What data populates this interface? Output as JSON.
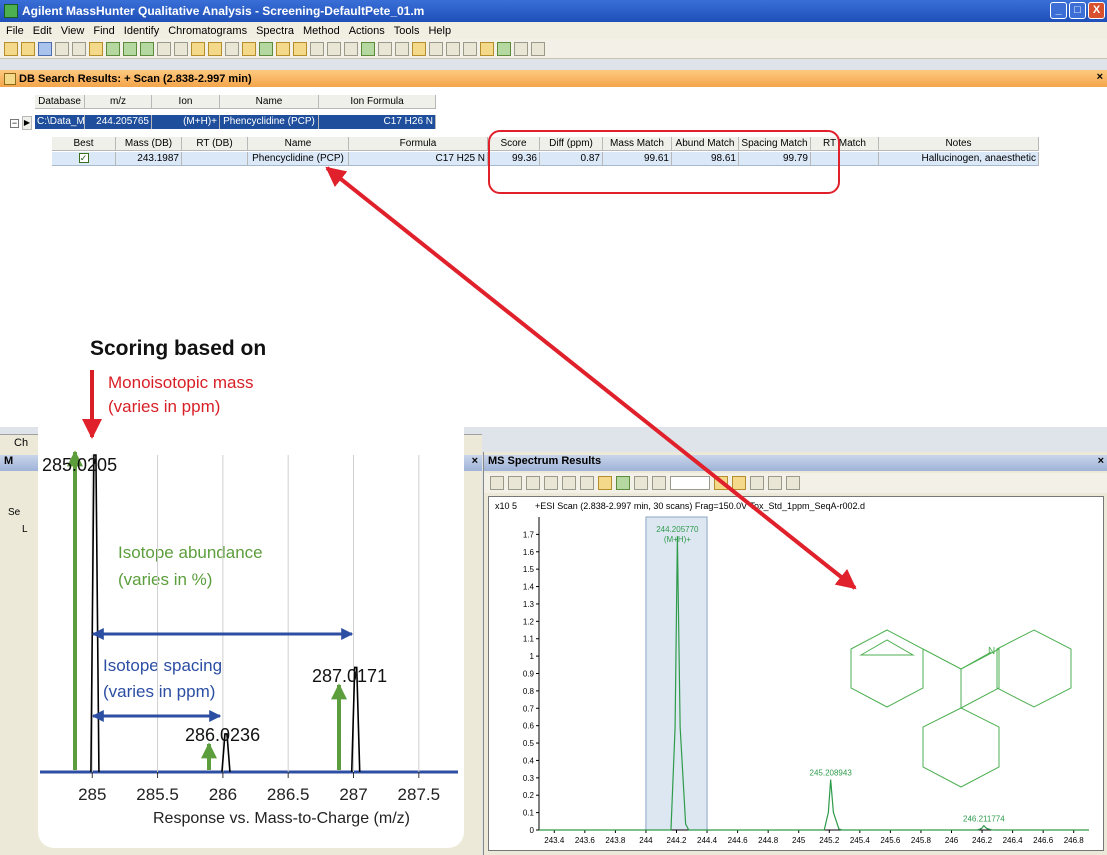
{
  "window": {
    "title": "Agilent MassHunter Qualitative Analysis - Screening-DefaultPete_01.m",
    "min_label": "_",
    "max_label": "□",
    "close_label": "X"
  },
  "menu": [
    "File",
    "Edit",
    "View",
    "Find",
    "Identify",
    "Chromatograms",
    "Spectra",
    "Method",
    "Actions",
    "Tools",
    "Help"
  ],
  "results_panel": {
    "title": "DB Search Results: + Scan (2.838-2.997 min)",
    "close": "×",
    "parent_headers": [
      "Database",
      "m/z",
      "Ion",
      "Name",
      "Ion Formula"
    ],
    "parent_row": [
      "C:\\Data_Mas...",
      "244.205765",
      "(M+H)+",
      "Phencyclidine (PCP)",
      "C17 H26 N"
    ],
    "child_headers": [
      "Best",
      "Mass (DB)",
      "RT (DB)",
      "Name",
      "Formula",
      "Score",
      "Diff (ppm)",
      "Mass Match",
      "Abund Match",
      "Spacing Match",
      "RT Match",
      "Notes"
    ],
    "child_row": [
      "✓",
      "243.1987",
      "",
      "Phencyclidine (PCP)",
      "C17 H25 N",
      "99.36",
      "0.87",
      "99.61",
      "98.61",
      "99.79",
      "",
      "Hallucinogen, anaesthetic"
    ]
  },
  "left_pane": {
    "tab_label": "Ch",
    "header": "M",
    "close": "×",
    "items": [
      "Se",
      "L"
    ]
  },
  "spectrum_panel": {
    "title": "MS Spectrum Results",
    "close": "×",
    "scale_label": "x10 5",
    "scan_info": "+ESI Scan (2.838-2.997 min, 30 scans) Frag=150.0V Tox_Std_1ppm_SeqA-r002.d",
    "peak_labels": [
      "244.205770",
      "(M+H)+",
      "245.208943",
      "246.211774"
    ],
    "structure_atom": "N"
  },
  "inset": {
    "title": "Scoring based on",
    "mono_label_1": "Monoisotopic mass",
    "mono_label_2": "(varies in ppm)",
    "abund_label_1": "Isotope abundance",
    "abund_label_2": "(varies in %)",
    "spacing_label_1": "Isotope spacing",
    "spacing_label_2": "(varies in ppm)",
    "peak_labels": [
      "285.0205",
      "286.0236",
      "287.0171"
    ],
    "xlabel": "Response vs. Mass-to-Charge (m/z)"
  },
  "chart_data": [
    {
      "type": "line",
      "title": "+ESI Scan (2.838-2.997 min, 30 scans) Frag=150.0V Tox_Std_1ppm_SeqA-r002.d",
      "xlabel": "",
      "ylabel": "x10 5",
      "xlim": [
        243.3,
        246.9
      ],
      "ylim": [
        0,
        1.8
      ],
      "x_ticks": [
        "243.4",
        "243.6",
        "243.8",
        "244",
        "244.2",
        "244.4",
        "244.6",
        "244.8",
        "245",
        "245.2",
        "245.4",
        "245.6",
        "245.8",
        "246",
        "246.2",
        "246.4",
        "246.6",
        "246.8"
      ],
      "y_ticks": [
        "0",
        "0.1",
        "0.2",
        "0.3",
        "0.4",
        "0.5",
        "0.6",
        "0.7",
        "0.8",
        "0.9",
        "1",
        "1.1",
        "1.2",
        "1.3",
        "1.4",
        "1.5",
        "1.6",
        "1.7"
      ],
      "peaks": [
        {
          "x": 244.20577,
          "y": 1.69,
          "label": "244.205770"
        },
        {
          "x": 245.208943,
          "y": 0.29,
          "label": "245.208943"
        },
        {
          "x": 246.211774,
          "y": 0.025,
          "label": "246.211774"
        }
      ],
      "highlight_range": [
        244.0,
        244.4
      ]
    },
    {
      "type": "line",
      "title": "",
      "xlabel": "Response vs. Mass-to-Charge (m/z)",
      "xlim": [
        284.6,
        287.8
      ],
      "x_ticks": [
        "285",
        "285.5",
        "286",
        "286.5",
        "287",
        "287.5"
      ],
      "peaks": [
        {
          "x": 285.0205,
          "y": 1.0,
          "label": "285.0205"
        },
        {
          "x": 286.0236,
          "y": 0.12,
          "label": "286.0236"
        },
        {
          "x": 287.0171,
          "y": 0.33,
          "label": "287.0171"
        }
      ]
    }
  ]
}
